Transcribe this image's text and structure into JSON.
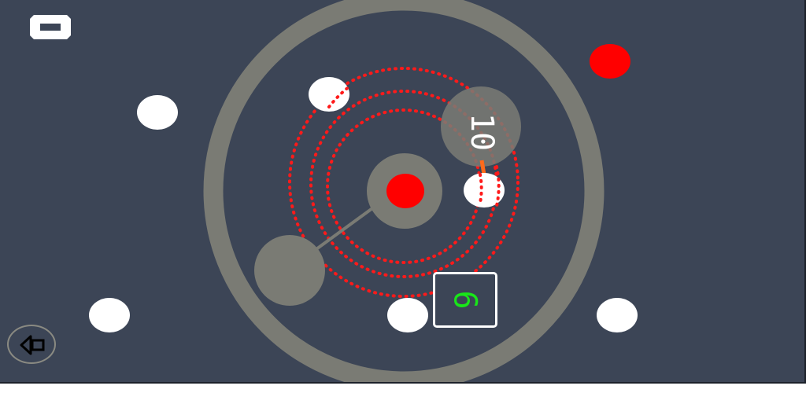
{
  "game": {
    "score": "10",
    "timer": "6"
  },
  "icons": {
    "menu": "minus-bar-icon",
    "back": "arrow-left-icon"
  },
  "colors": {
    "background": "#3c4556",
    "ring": "#7a7b74",
    "hub": "#7a7b74",
    "red_ball": "#ff0000",
    "white_ball": "#ffffff",
    "orbit_dots": "#ff1a1a",
    "timer_text": "#19e619",
    "aim_line": "#ff6a1a"
  }
}
